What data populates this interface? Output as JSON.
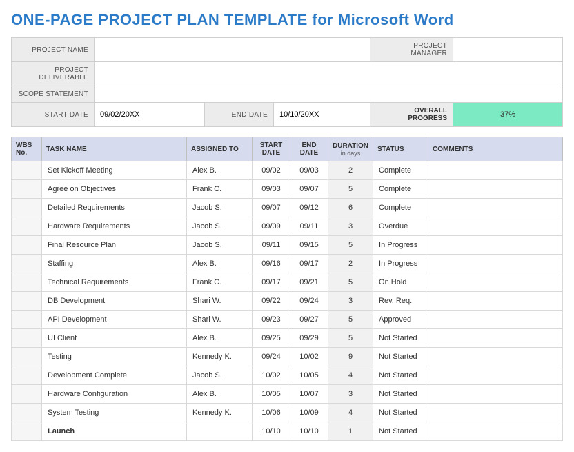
{
  "title": "ONE-PAGE PROJECT PLAN TEMPLATE for Microsoft Word",
  "meta": {
    "labels": {
      "project_name": "PROJECT NAME",
      "project_manager": "PROJECT MANAGER",
      "project_deliverable": "PROJECT DELIVERABLE",
      "scope_statement": "SCOPE STATEMENT",
      "start_date": "START DATE",
      "end_date": "END DATE",
      "overall_progress": "OVERALL PROGRESS"
    },
    "values": {
      "project_name": "",
      "project_manager": "",
      "project_deliverable": "",
      "scope_statement": "",
      "start_date": "09/02/20XX",
      "end_date": "10/10/20XX",
      "overall_progress": "37%"
    }
  },
  "table": {
    "headers": {
      "wbs": "WBS No.",
      "task": "TASK NAME",
      "assigned": "ASSIGNED TO",
      "start": "START DATE",
      "end": "END DATE",
      "duration": "DURATION",
      "duration_sub": "in days",
      "status": "STATUS",
      "comments": "COMMENTS"
    },
    "rows": [
      {
        "wbs": "",
        "task": "Set Kickoff Meeting",
        "assigned": "Alex B.",
        "start": "09/02",
        "end": "09/03",
        "duration": "2",
        "status": "Complete",
        "status_class": "Complete",
        "comments": ""
      },
      {
        "wbs": "",
        "task": "Agree on Objectives",
        "assigned": "Frank C.",
        "start": "09/03",
        "end": "09/07",
        "duration": "5",
        "status": "Complete",
        "status_class": "Complete",
        "comments": ""
      },
      {
        "wbs": "",
        "task": "Detailed Requirements",
        "assigned": "Jacob S.",
        "start": "09/07",
        "end": "09/12",
        "duration": "6",
        "status": "Complete",
        "status_class": "Complete",
        "comments": ""
      },
      {
        "wbs": "",
        "task": "Hardware Requirements",
        "assigned": "Jacob S.",
        "start": "09/09",
        "end": "09/11",
        "duration": "3",
        "status": "Overdue",
        "status_class": "Overdue",
        "comments": ""
      },
      {
        "wbs": "",
        "task": "Final Resource Plan",
        "assigned": "Jacob S.",
        "start": "09/11",
        "end": "09/15",
        "duration": "5",
        "status": "In Progress",
        "status_class": "InProgress",
        "comments": ""
      },
      {
        "wbs": "",
        "task": "Staffing",
        "assigned": "Alex B.",
        "start": "09/16",
        "end": "09/17",
        "duration": "2",
        "status": "In Progress",
        "status_class": "InProgress",
        "comments": ""
      },
      {
        "wbs": "",
        "task": "Technical Requirements",
        "assigned": "Frank C.",
        "start": "09/17",
        "end": "09/21",
        "duration": "5",
        "status": "On Hold",
        "status_class": "OnHold",
        "comments": ""
      },
      {
        "wbs": "",
        "task": "DB Development",
        "assigned": "Shari W.",
        "start": "09/22",
        "end": "09/24",
        "duration": "3",
        "status": "Rev. Req.",
        "status_class": "RevReq",
        "comments": ""
      },
      {
        "wbs": "",
        "task": "API Development",
        "assigned": "Shari W.",
        "start": "09/23",
        "end": "09/27",
        "duration": "5",
        "status": "Approved",
        "status_class": "Approved",
        "comments": ""
      },
      {
        "wbs": "",
        "task": "UI Client",
        "assigned": "Alex B.",
        "start": "09/25",
        "end": "09/29",
        "duration": "5",
        "status": "Not Started",
        "status_class": "NotStarted",
        "comments": ""
      },
      {
        "wbs": "",
        "task": "Testing",
        "assigned": "Kennedy K.",
        "start": "09/24",
        "end": "10/02",
        "duration": "9",
        "status": "Not Started",
        "status_class": "NotStarted",
        "comments": ""
      },
      {
        "wbs": "",
        "task": "Development Complete",
        "assigned": "Jacob S.",
        "start": "10/02",
        "end": "10/05",
        "duration": "4",
        "status": "Not Started",
        "status_class": "NotStarted",
        "comments": ""
      },
      {
        "wbs": "",
        "task": "Hardware Configuration",
        "assigned": "Alex B.",
        "start": "10/05",
        "end": "10/07",
        "duration": "3",
        "status": "Not Started",
        "status_class": "NotStarted",
        "comments": ""
      },
      {
        "wbs": "",
        "task": "System Testing",
        "assigned": "Kennedy K.",
        "start": "10/06",
        "end": "10/09",
        "duration": "4",
        "status": "Not Started",
        "status_class": "NotStarted",
        "comments": ""
      },
      {
        "wbs": "",
        "task": "Launch",
        "assigned": "",
        "start": "10/10",
        "end": "10/10",
        "duration": "1",
        "status": "Not Started",
        "status_class": "NotStarted",
        "comments": "",
        "bold": true
      }
    ]
  },
  "chart_data": {
    "type": "table",
    "title": "One-Page Project Plan",
    "columns": [
      "WBS No.",
      "TASK NAME",
      "ASSIGNED TO",
      "START DATE",
      "END DATE",
      "DURATION (days)",
      "STATUS",
      "COMMENTS"
    ],
    "overall_progress_pct": 37,
    "project_start": "09/02/20XX",
    "project_end": "10/10/20XX",
    "status_colors": {
      "Complete": "#3FC68E",
      "Overdue": "#F5A900",
      "In Progress": "#9FD94A",
      "On Hold": "#D7D7D7",
      "Rev. Req.": "#A9F0DA",
      "Approved": "#9FD1F2",
      "Not Started": "#FBE6B9"
    }
  }
}
